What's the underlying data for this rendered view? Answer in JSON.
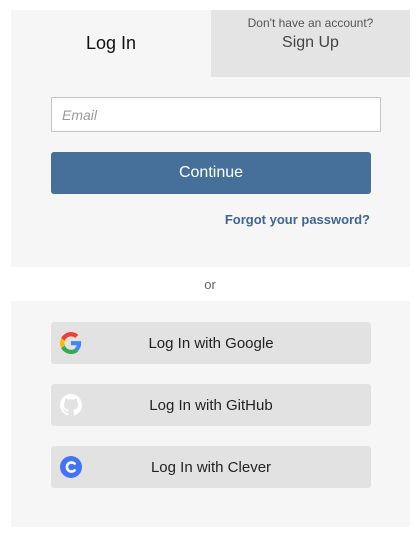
{
  "tabs": {
    "login_label": "Log In",
    "signup_hint": "Don't have an account?",
    "signup_label": "Sign Up"
  },
  "form": {
    "email_placeholder": "Email",
    "email_value": "",
    "continue_label": "Continue",
    "forgot_label": "Forgot your password?"
  },
  "divider_text": "or",
  "sso": [
    {
      "label": "Log In with Google",
      "icon": "google-icon"
    },
    {
      "label": "Log In with GitHub",
      "icon": "github-icon"
    },
    {
      "label": "Log In with Clever",
      "icon": "clever-icon"
    }
  ],
  "colors": {
    "primary": "#46709a",
    "link": "#3f6590",
    "card_bg": "#f6f6f6",
    "inactive_tab": "#e4e4e4",
    "sso_bg": "#e2e2e2",
    "clever_blue": "#4274f6"
  }
}
